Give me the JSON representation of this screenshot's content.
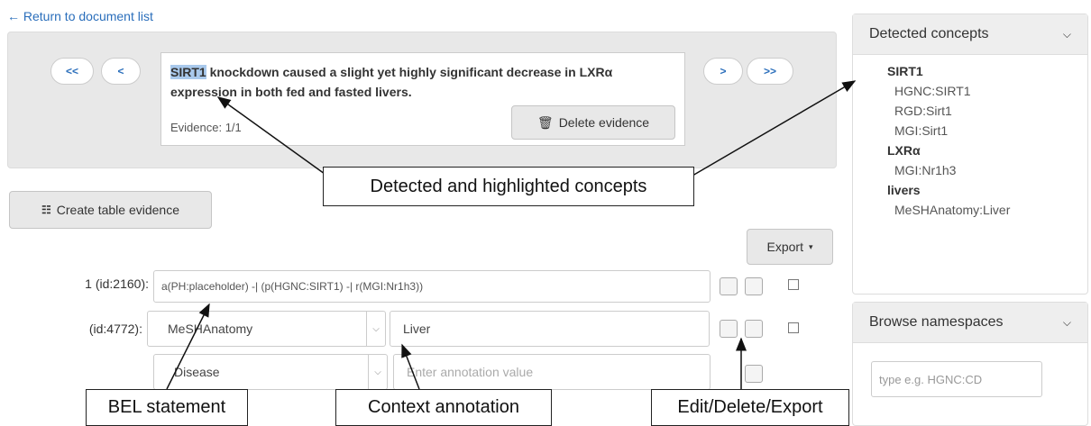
{
  "nav": {
    "return_label": "Return to document list"
  },
  "evidence": {
    "first_label": "<<",
    "prev_label": "<",
    "next_label": ">",
    "last_label": ">>",
    "highlight_term": "SIRT1",
    "sentence_rest": " knockdown caused a slight yet highly significant decrease in LXRα expression in both fed and fasted livers.",
    "count": "Evidence: 1/1",
    "delete_label": "Delete evidence"
  },
  "toolbar": {
    "create_table_label": "Create table evidence",
    "export_label": "Export"
  },
  "statements": {
    "bel": {
      "label": "1 (id:2160):",
      "value": "a(PH:placeholder) -| (p(HGNC:SIRT1) -| r(MGI:Nr1h3))"
    },
    "annotation": {
      "label": "(id:4772):",
      "namespace": "MeSHAnatomy",
      "value": "Liver"
    },
    "new_annotation": {
      "namespace": "Disease",
      "placeholder": "Enter annotation value"
    }
  },
  "detected_concepts": {
    "title": "Detected concepts",
    "groups": [
      {
        "term": "SIRT1",
        "ids": [
          "HGNC:SIRT1",
          "RGD:Sirt1",
          "MGI:Sirt1"
        ]
      },
      {
        "term": "LXRα",
        "ids": [
          "MGI:Nr1h3"
        ]
      },
      {
        "term": "livers",
        "ids": [
          "MeSHAnatomy:Liver"
        ]
      }
    ]
  },
  "browse": {
    "title": "Browse namespaces",
    "placeholder": "type e.g. HGNC:CD"
  },
  "callouts": {
    "concepts": "Detected and highlighted concepts",
    "bel": "BEL statement",
    "context": "Context annotation",
    "actions": "Edit/Delete/Export"
  },
  "colors": {
    "link": "#2a6ebb",
    "highlight": "#a9c9ec",
    "panel": "#e8e8e8"
  }
}
